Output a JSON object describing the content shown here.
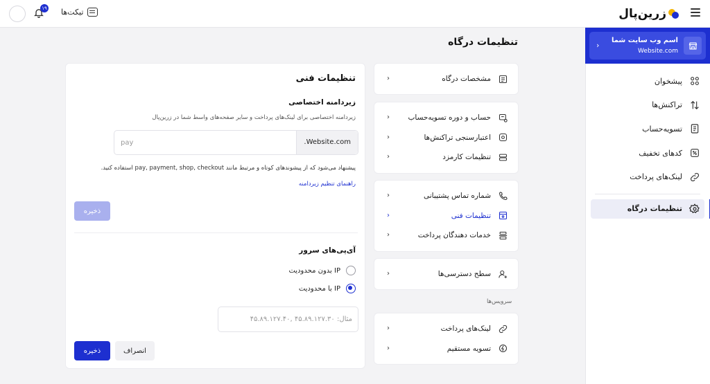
{
  "topbar": {
    "logo_text": "زرین‌پال",
    "tickets_label": "تیکت‌ها",
    "notification_count": "۱۹"
  },
  "sidebar": {
    "site_name": "اسم وب سایت شما",
    "site_url": "Website.com",
    "items": [
      {
        "label": "پیشخوان",
        "icon": "dashboard-icon"
      },
      {
        "label": "تراکنش‌ها",
        "icon": "transactions-icon"
      },
      {
        "label": "تسویه‌حساب",
        "icon": "settlement-icon"
      },
      {
        "label": "کدهای تخفیف",
        "icon": "discount-icon"
      },
      {
        "label": "لینک‌های پرداخت",
        "icon": "link-icon"
      }
    ],
    "active_item": {
      "label": "تنظیمات درگاه",
      "icon": "gear-icon"
    }
  },
  "page": {
    "title": "تنظیمات درگاه"
  },
  "menu": {
    "groups": [
      [
        {
          "label": "مشخصات درگاه",
          "icon": "gateway-info-icon"
        }
      ],
      [
        {
          "label": "حساب و دوره تسویه‌حساب",
          "icon": "account-cycle-icon"
        },
        {
          "label": "اعتبارسنجی تراکنش‌ها",
          "icon": "validation-icon"
        },
        {
          "label": "تنظیمات کارمزد",
          "icon": "fee-icon"
        }
      ],
      [
        {
          "label": "شماره تماس پشتیبانی",
          "icon": "phone-icon"
        },
        {
          "label": "تنظیمات فنی",
          "icon": "technical-icon",
          "active": true
        },
        {
          "label": "خدمات دهندگان پرداخت",
          "icon": "providers-icon"
        }
      ],
      [
        {
          "label": "سطح دسترسی‌ها",
          "icon": "user-access-icon"
        }
      ]
    ],
    "services_caption": "سرویس‌ها",
    "services": [
      {
        "label": "لینک‌های پرداخت",
        "icon": "payment-link-icon"
      },
      {
        "label": "تسویه مستقیم",
        "icon": "direct-settlement-icon"
      }
    ]
  },
  "panel": {
    "title": "تنظیمات فنی",
    "subdomain": {
      "title": "زیردامنه اختصاصی",
      "description": "زیردامنه اختصاصی برای لینک‌های پرداخت و سایر صفحه‌های واسط شما در زرین‌پال",
      "suffix": ".Website.com",
      "placeholder": "pay",
      "hint": "پیشنهاد می‌شود که از پیشوندهای کوتاه و مرتبط مانند pay, payment, shop, checkout استفاده کنید.",
      "guide_link": "راهنمای تنظیم زیردامنه",
      "save_label": "ذخیره"
    },
    "server_ips": {
      "title": "آی‌پی‌های سرور",
      "options": [
        {
          "label": "بدون محدودیت IP",
          "checked": false
        },
        {
          "label": "با محدودیت IP",
          "checked": true
        }
      ],
      "placeholder": "مثال: ۴۵.۸۹.۱۲۷.۳۰ ,۴۵.۸۹.۱۲۷.۴۰",
      "save_label": "ذخیره",
      "cancel_label": "انصراف"
    }
  },
  "colors": {
    "primary": "#1d2fd0",
    "primary_disabled": "#a9b0ee",
    "logo_yellow": "#f4b400",
    "background": "#f3f3f5"
  }
}
